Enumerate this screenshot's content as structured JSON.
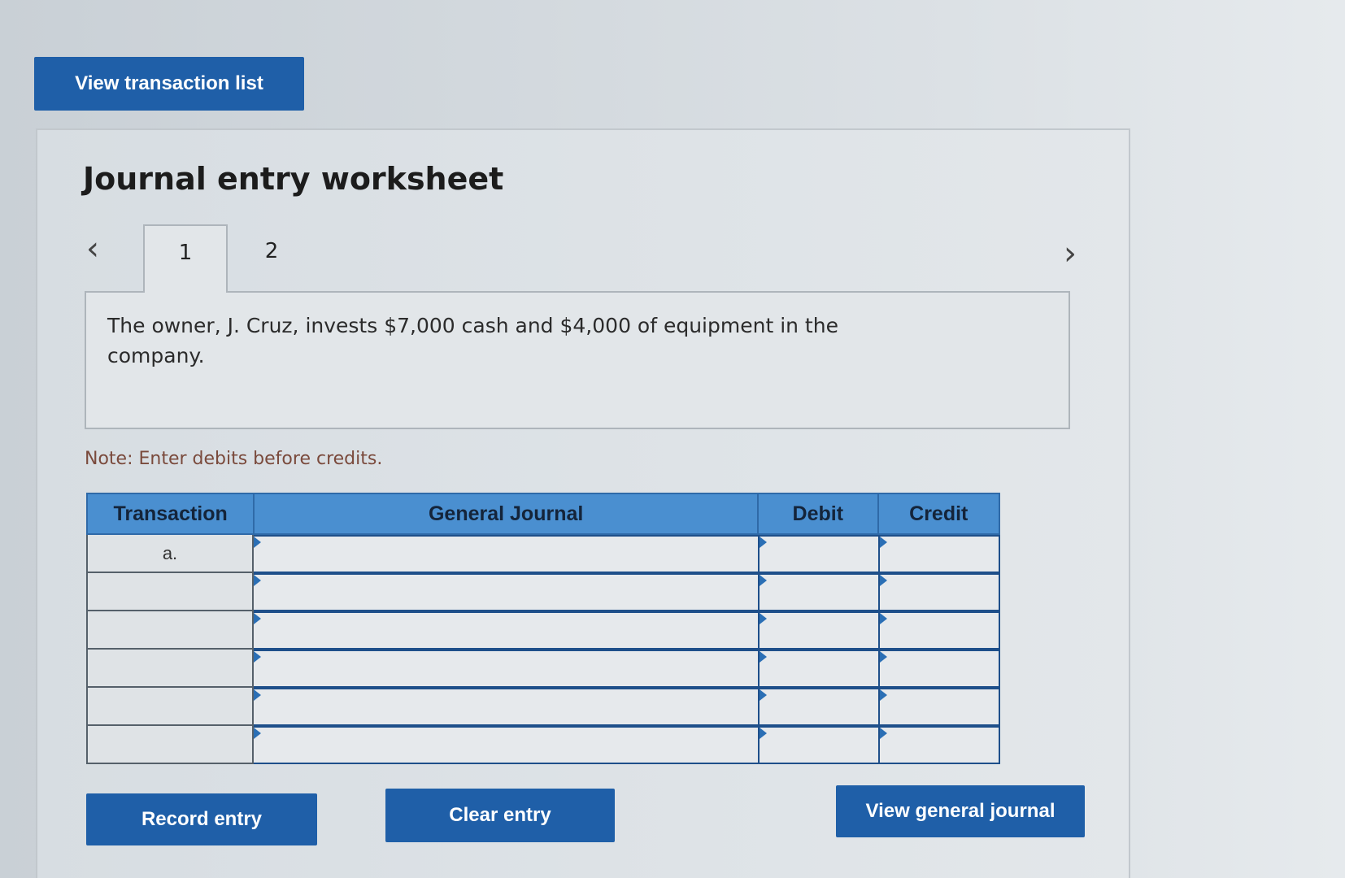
{
  "top_button": {
    "label": "View transaction list"
  },
  "worksheet": {
    "title": "Journal entry worksheet",
    "prev_icon": "chevron-left-icon",
    "next_icon": "chevron-right-icon",
    "tabs": [
      {
        "label": "1",
        "active": true
      },
      {
        "label": "2",
        "active": false
      }
    ],
    "description": "The owner, J. Cruz, invests $7,000 cash and $4,000 of equipment in the company.",
    "note": "Note: Enter debits before credits."
  },
  "journal_table": {
    "headers": [
      "Transaction",
      "General Journal",
      "Debit",
      "Credit"
    ],
    "rows": [
      {
        "transaction": "a.",
        "account": "",
        "debit": "",
        "credit": ""
      },
      {
        "transaction": "",
        "account": "",
        "debit": "",
        "credit": ""
      },
      {
        "transaction": "",
        "account": "",
        "debit": "",
        "credit": ""
      },
      {
        "transaction": "",
        "account": "",
        "debit": "",
        "credit": ""
      },
      {
        "transaction": "",
        "account": "",
        "debit": "",
        "credit": ""
      },
      {
        "transaction": "",
        "account": "",
        "debit": "",
        "credit": ""
      }
    ]
  },
  "actions": {
    "record": "Record entry",
    "clear": "Clear entry",
    "view_journal": "View general journal"
  },
  "colors": {
    "button_bg": "#1f5fa8",
    "table_header_bg": "#4a8fd0",
    "input_border": "#1e4f8a",
    "note_text": "#7a4a3c"
  }
}
